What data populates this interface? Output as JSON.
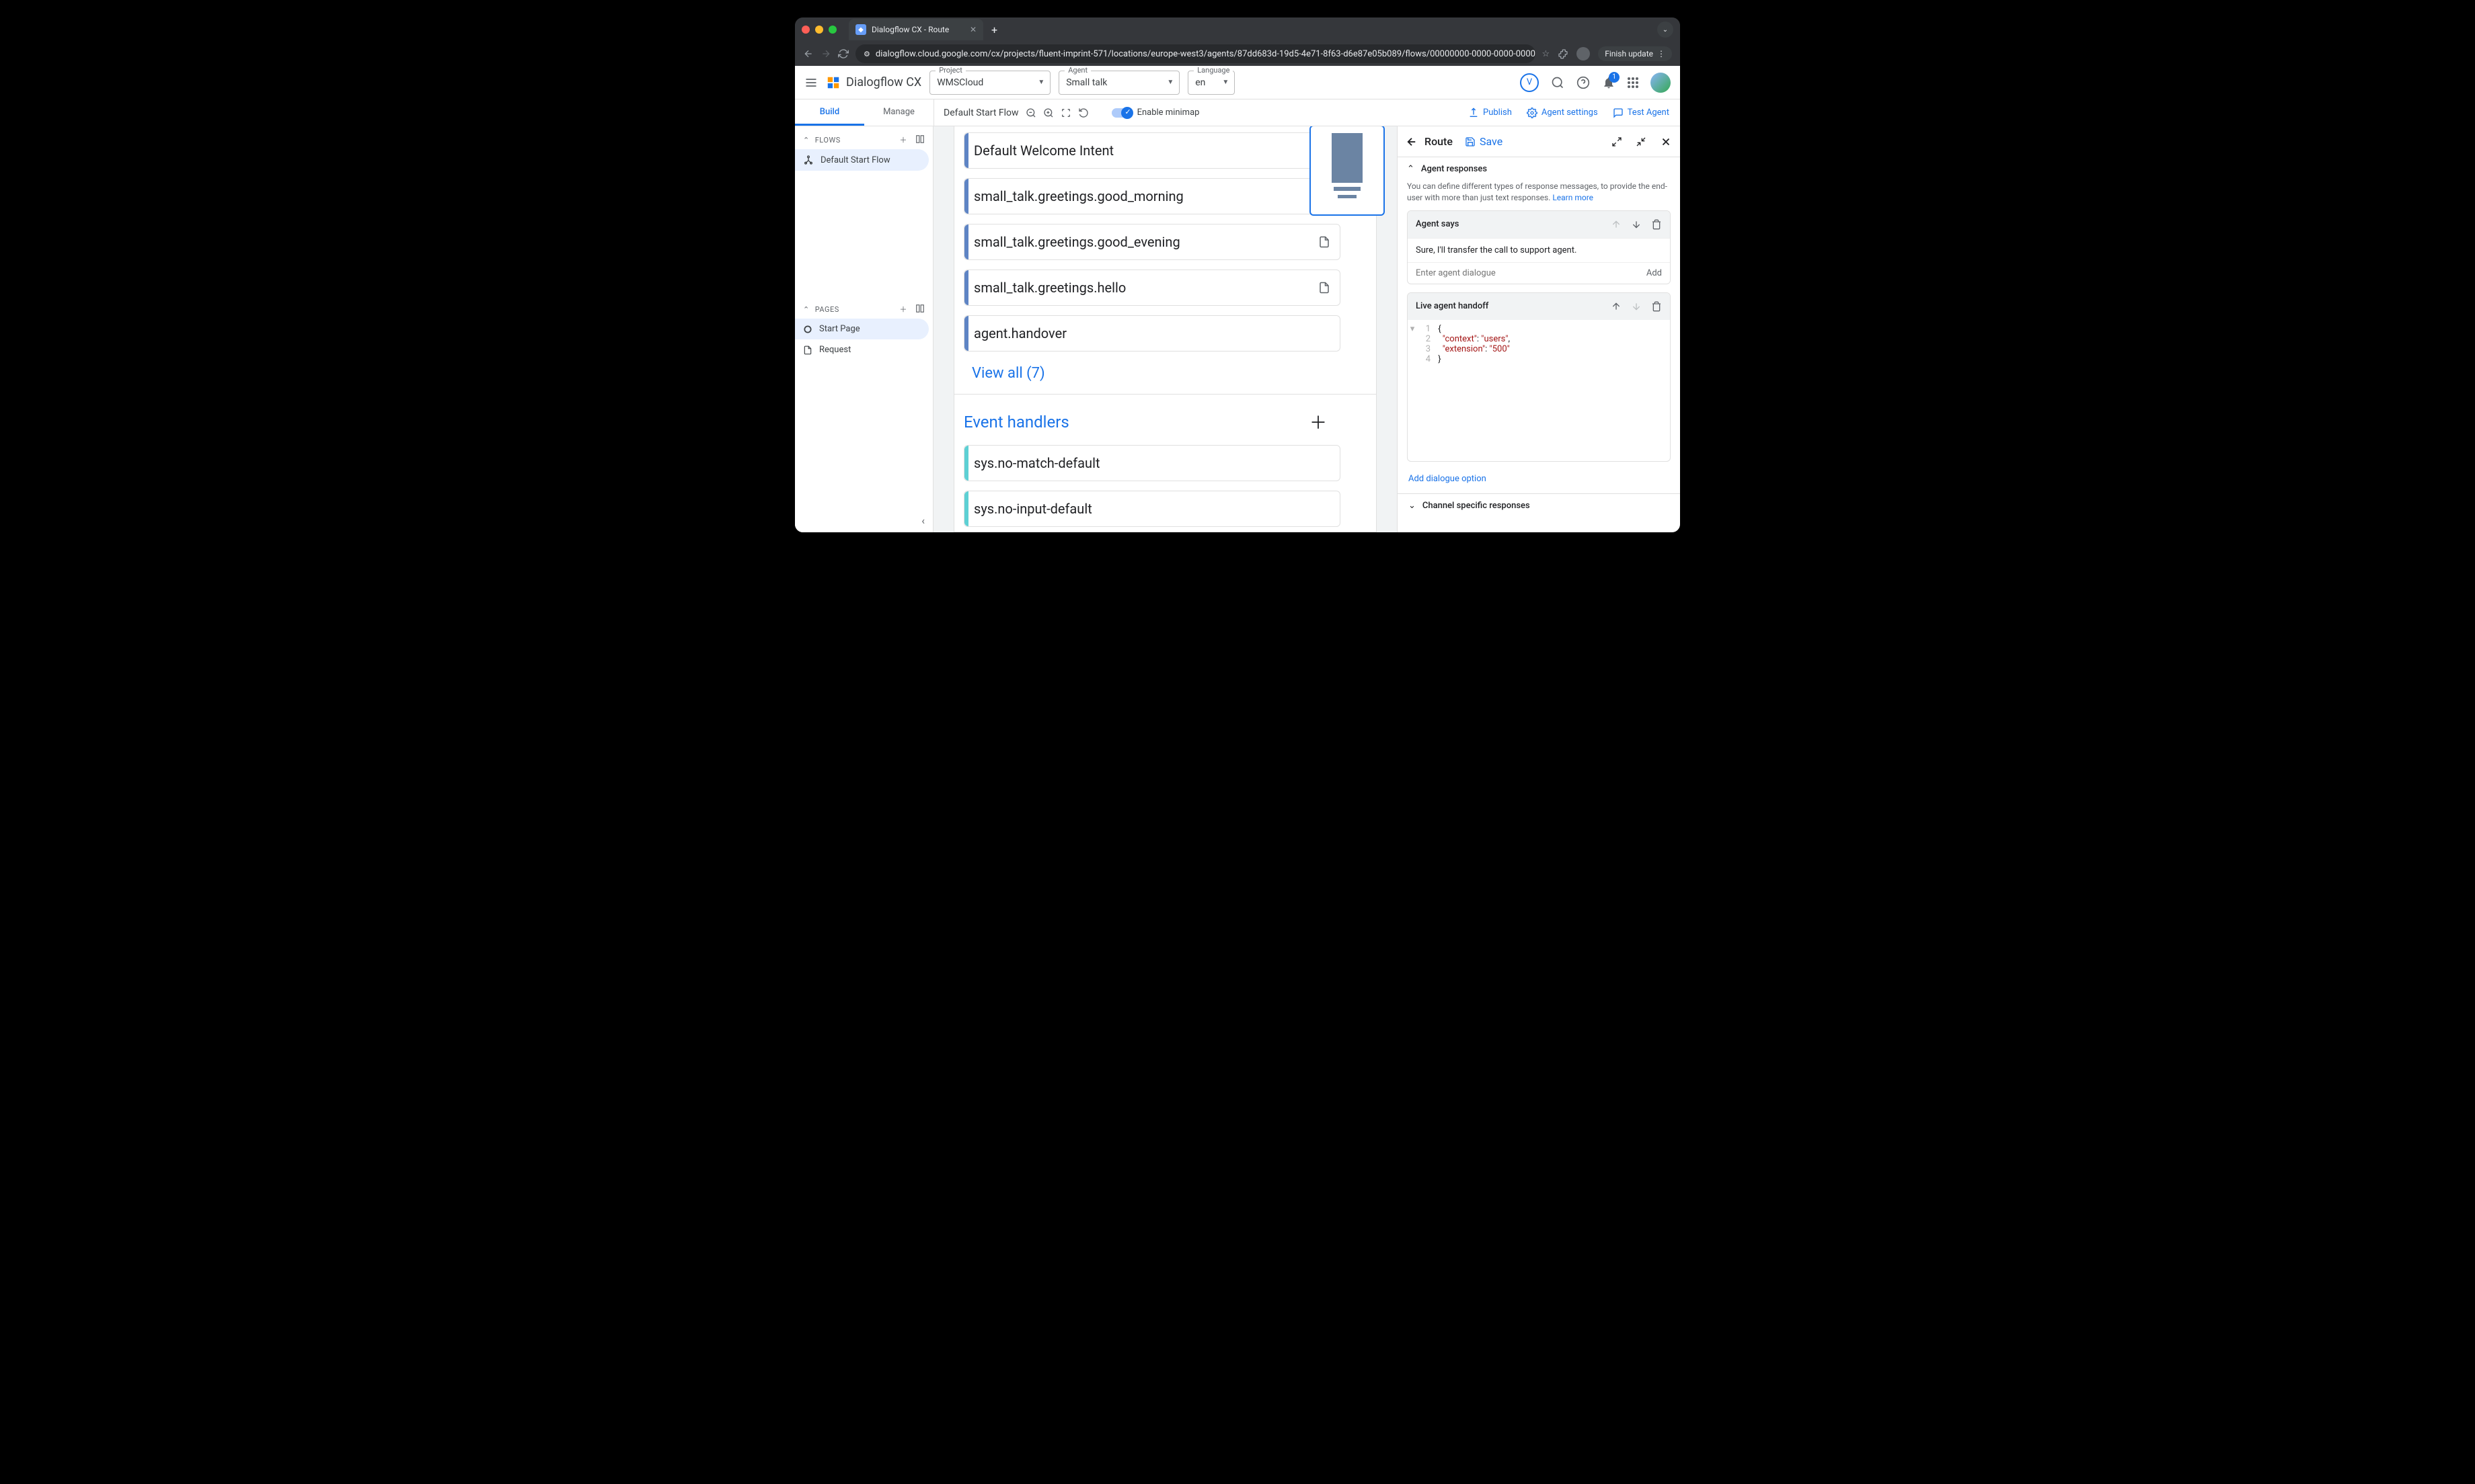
{
  "browser": {
    "tab_title": "Dialogflow CX - Route",
    "url": "dialogflow.cloud.google.com/cx/projects/fluent-imprint-571/locations/europe-west3/agents/87dd683d-19d5-4e71-8f63-d6e87e05b089/flows/00000000-0000-0000-0000-000000000000/flo...",
    "finish_update": "Finish update"
  },
  "app": {
    "product": "Dialogflow CX",
    "project_label": "Project",
    "project": "WMSCloud",
    "agent_label": "Agent",
    "agent": "Small talk",
    "language_label": "Language",
    "language": "en",
    "user_initial": "V",
    "notification_count": "1"
  },
  "subnav": {
    "build": "Build",
    "manage": "Manage",
    "flow_name": "Default Start Flow",
    "minimap": "Enable minimap",
    "publish": "Publish",
    "agent_settings": "Agent settings",
    "test_agent": "Test Agent"
  },
  "left": {
    "flows_header": "FLOWS",
    "flows": [
      "Default Start Flow"
    ],
    "pages_header": "PAGES",
    "pages": [
      "Start Page",
      "Request"
    ]
  },
  "canvas": {
    "routes": [
      "Default Welcome Intent",
      "small_talk.greetings.good_morning",
      "small_talk.greetings.good_evening",
      "small_talk.greetings.hello",
      "agent.handover"
    ],
    "view_all": "View all (7)",
    "event_handlers_title": "Event handlers",
    "events": [
      "sys.no-match-default",
      "sys.no-input-default"
    ]
  },
  "right": {
    "title": "Route",
    "save": "Save",
    "section_title": "Agent responses",
    "desc": "You can define different types of response messages, to provide the end-user with more than just text responses. ",
    "learn_more": "Learn more",
    "agent_says": {
      "title": "Agent says",
      "text": "Sure, I'll transfer the call to support agent.",
      "placeholder": "Enter agent dialogue",
      "add": "Add"
    },
    "handoff": {
      "title": "Live agent handoff",
      "json": {
        "k1": "context",
        "v1": "users",
        "k2": "extension",
        "v2": "500"
      }
    },
    "add_option": "Add dialogue option",
    "channel_title": "Channel specific responses"
  }
}
